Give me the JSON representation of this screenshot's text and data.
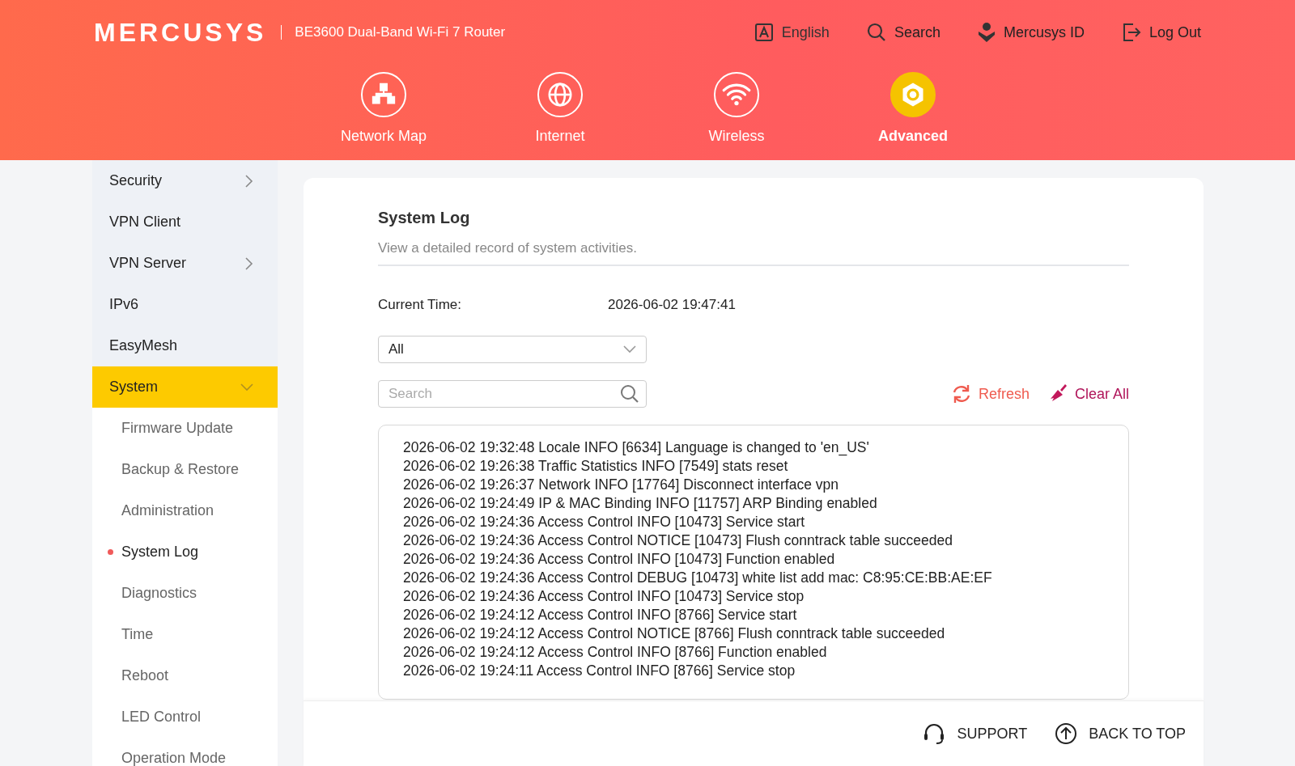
{
  "header": {
    "logo": "MERCUSYS",
    "model": "BE3600 Dual-Band Wi-Fi 7 Router",
    "actions": [
      {
        "kind": "language",
        "label": "English"
      },
      {
        "kind": "search",
        "label": "Search"
      },
      {
        "kind": "account",
        "label": "Mercusys ID"
      },
      {
        "kind": "logout",
        "label": "Log Out"
      }
    ],
    "nav": [
      {
        "kind": "network",
        "label": "Network Map",
        "selected": false
      },
      {
        "kind": "internet",
        "label": "Internet",
        "selected": false
      },
      {
        "kind": "wireless",
        "label": "Wireless",
        "selected": false
      },
      {
        "kind": "advanced",
        "label": "Advanced",
        "selected": true
      }
    ]
  },
  "sidebar": {
    "items": [
      {
        "label": "Security",
        "expanded": false,
        "selected": false
      },
      {
        "label": "VPN Client",
        "selected": false
      },
      {
        "label": "VPN Server",
        "expanded": false,
        "selected": false
      },
      {
        "label": "IPv6",
        "selected": false
      },
      {
        "label": "EasyMesh",
        "selected": false
      },
      {
        "label": "System",
        "expanded": true,
        "selected": true,
        "children": [
          {
            "label": "Firmware Update",
            "selected": false
          },
          {
            "label": "Backup & Restore",
            "selected": false
          },
          {
            "label": "Administration",
            "selected": false
          },
          {
            "label": "System Log",
            "selected": true
          },
          {
            "label": "Diagnostics",
            "selected": false
          },
          {
            "label": "Time",
            "selected": false
          },
          {
            "label": "Reboot",
            "selected": false
          },
          {
            "label": "LED Control",
            "selected": false
          },
          {
            "label": "Operation Mode",
            "selected": false
          }
        ]
      }
    ]
  },
  "content": {
    "title": "System Log",
    "subtitle": "View a detailed record of system activities.",
    "current_time_label": "Current Time:",
    "current_time": "2026-06-02 19:47:41",
    "filter": {
      "value": "All"
    },
    "search": {
      "placeholder": "Search"
    },
    "buttons": [
      {
        "kind": "refresh",
        "label": "Refresh"
      },
      {
        "kind": "clear",
        "label": "Clear All"
      }
    ],
    "log": [
      "2026-06-02 19:32:48 Locale INFO [6634] Language is changed to 'en_US'",
      "2026-06-02 19:26:38 Traffic Statistics INFO [7549] stats reset",
      "2026-06-02 19:26:37 Network INFO [17764] Disconnect interface vpn",
      "2026-06-02 19:24:49 IP & MAC Binding INFO [11757] ARP Binding enabled",
      "2026-06-02 19:24:36 Access Control INFO [10473] Service start",
      "2026-06-02 19:24:36 Access Control NOTICE [10473] Flush conntrack table succeeded",
      "2026-06-02 19:24:36 Access Control INFO [10473] Function enabled",
      "2026-06-02 19:24:36 Access Control DEBUG [10473] white list add mac: C8:95:CE:BB:AE:EF",
      "2026-06-02 19:24:36 Access Control INFO [10473] Service stop",
      "2026-06-02 19:24:12 Access Control INFO [8766] Service start",
      "2026-06-02 19:24:12 Access Control NOTICE [8766] Flush conntrack table succeeded",
      "2026-06-02 19:24:12 Access Control INFO [8766] Function enabled",
      "2026-06-02 19:24:11 Access Control INFO [8766] Service stop"
    ]
  },
  "footer": {
    "links": [
      {
        "kind": "support",
        "label": "SUPPORT"
      },
      {
        "kind": "top",
        "label": "BACK TO TOP"
      }
    ]
  }
}
